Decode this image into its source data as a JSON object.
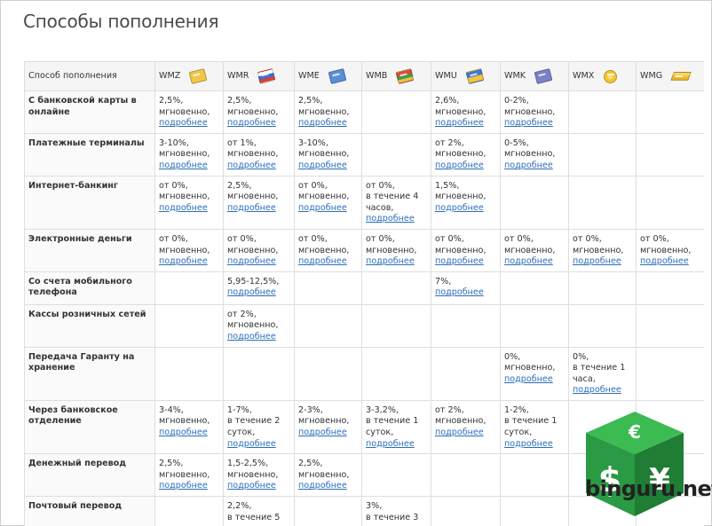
{
  "page": {
    "title": "Способы пополнения"
  },
  "table": {
    "header_label": "Способ пополнения",
    "columns": [
      {
        "code": "WMZ",
        "icon": "wallet-icon",
        "color": "#f0c648"
      },
      {
        "code": "WMR",
        "icon": "wallet-icon",
        "color": "#e36b4a"
      },
      {
        "code": "WME",
        "icon": "wallet-icon",
        "color": "#5a8fd6"
      },
      {
        "code": "WMB",
        "icon": "wallet-icon",
        "color": "#e8b23a"
      },
      {
        "code": "WMU",
        "icon": "wallet-icon",
        "color": "#f2c438"
      },
      {
        "code": "WMK",
        "icon": "wallet-icon",
        "color": "#7b80c9"
      },
      {
        "code": "WMX",
        "icon": "coin-icon",
        "color": "#f3c530"
      },
      {
        "code": "WMG",
        "icon": "gold-bar-icon",
        "color": "#f1b820"
      }
    ],
    "rows": [
      {
        "label": "С банковской карты в онлайне",
        "cells": [
          {
            "lines": [
              "2,5%,",
              "мгновенно,"
            ],
            "link": "подробнее"
          },
          {
            "lines": [
              "2,5%,",
              "мгновенно,"
            ],
            "link": "подробнее"
          },
          {
            "lines": [
              "2,5%,",
              "мгновенно,"
            ],
            "link": "подробнее"
          },
          {
            "lines": [],
            "link": ""
          },
          {
            "lines": [
              "2,6%,",
              "мгновенно,"
            ],
            "link": "подробнее"
          },
          {
            "lines": [
              "0-2%,",
              "мгновенно,"
            ],
            "link": "подробнее"
          },
          {
            "lines": [],
            "link": ""
          },
          {
            "lines": [],
            "link": ""
          }
        ]
      },
      {
        "label": "Платежные терминалы",
        "cells": [
          {
            "lines": [
              "3-10%,",
              "мгновенно,"
            ],
            "link": "подробнее"
          },
          {
            "lines": [
              "от 1%,",
              "мгновенно,"
            ],
            "link": "подробнее"
          },
          {
            "lines": [
              "3-10%,",
              "мгновенно,"
            ],
            "link": "подробнее"
          },
          {
            "lines": [],
            "link": ""
          },
          {
            "lines": [
              "от 2%,",
              "мгновенно,"
            ],
            "link": "подробнее"
          },
          {
            "lines": [
              "0-5%,",
              "мгновенно,"
            ],
            "link": "подробнее"
          },
          {
            "lines": [],
            "link": ""
          },
          {
            "lines": [],
            "link": ""
          }
        ]
      },
      {
        "label": "Интернет-банкинг",
        "cells": [
          {
            "lines": [
              "от 0%,",
              "мгновенно,"
            ],
            "link": "подробнее"
          },
          {
            "lines": [
              "2,5%,",
              "мгновенно,"
            ],
            "link": "подробнее"
          },
          {
            "lines": [
              "от 0%,",
              "мгновенно,"
            ],
            "link": "подробнее"
          },
          {
            "lines": [
              "от 0%,",
              "в течение 4",
              "часов,"
            ],
            "link": "подробнее"
          },
          {
            "lines": [
              "1,5%,",
              "мгновенно,"
            ],
            "link": "подробнее"
          },
          {
            "lines": [],
            "link": ""
          },
          {
            "lines": [],
            "link": ""
          },
          {
            "lines": [],
            "link": ""
          }
        ]
      },
      {
        "label": "Электронные деньги",
        "cells": [
          {
            "lines": [
              "от 0%,",
              "мгновенно,"
            ],
            "link": "подробнее"
          },
          {
            "lines": [
              "от 0%,",
              "мгновенно,"
            ],
            "link": "подробнее"
          },
          {
            "lines": [
              "от 0%,",
              "мгновенно,"
            ],
            "link": "подробнее"
          },
          {
            "lines": [
              "от 0%,",
              "мгновенно,"
            ],
            "link": "подробнее"
          },
          {
            "lines": [
              "от 0%,",
              "мгновенно,"
            ],
            "link": "подробнее"
          },
          {
            "lines": [
              "от 0%,",
              "мгновенно,"
            ],
            "link": "подробнее"
          },
          {
            "lines": [
              "от 0%,",
              "мгновенно,"
            ],
            "link": "подробнее"
          },
          {
            "lines": [
              "от 0%,",
              "мгновенно,"
            ],
            "link": "подробнее"
          }
        ]
      },
      {
        "label": "Со счета мобильного телефона",
        "cells": [
          {
            "lines": [],
            "link": ""
          },
          {
            "lines": [
              "5,95-12,5%,"
            ],
            "link": "подробнее"
          },
          {
            "lines": [],
            "link": ""
          },
          {
            "lines": [],
            "link": ""
          },
          {
            "lines": [
              "7%,"
            ],
            "link": "подробнее"
          },
          {
            "lines": [],
            "link": ""
          },
          {
            "lines": [],
            "link": ""
          },
          {
            "lines": [],
            "link": ""
          }
        ]
      },
      {
        "label": "Кассы розничных сетей",
        "cells": [
          {
            "lines": [],
            "link": ""
          },
          {
            "lines": [
              "от 2%,",
              "мгновенно,"
            ],
            "link": "подробнее"
          },
          {
            "lines": [],
            "link": ""
          },
          {
            "lines": [],
            "link": ""
          },
          {
            "lines": [],
            "link": ""
          },
          {
            "lines": [],
            "link": ""
          },
          {
            "lines": [],
            "link": ""
          },
          {
            "lines": [],
            "link": ""
          }
        ]
      },
      {
        "label": "Передача Гаранту на хранение",
        "cells": [
          {
            "lines": [],
            "link": ""
          },
          {
            "lines": [],
            "link": ""
          },
          {
            "lines": [],
            "link": ""
          },
          {
            "lines": [],
            "link": ""
          },
          {
            "lines": [],
            "link": ""
          },
          {
            "lines": [
              "0%,",
              "мгновенно,"
            ],
            "link": "подробнее"
          },
          {
            "lines": [
              "0%,",
              "в течение 1",
              "часа,"
            ],
            "link": "подробнее"
          },
          {
            "lines": [],
            "link": ""
          }
        ]
      },
      {
        "label": "Через банковское отделение",
        "cells": [
          {
            "lines": [
              "3-4%,",
              "мгновенно,"
            ],
            "link": "подробнее"
          },
          {
            "lines": [
              "1-7%,",
              "в течение 2",
              "суток,"
            ],
            "link": "подробнее"
          },
          {
            "lines": [
              "2-3%,",
              "мгновенно,"
            ],
            "link": "подробнее"
          },
          {
            "lines": [
              "3-3,2%,",
              "в течение 1",
              "суток,"
            ],
            "link": "подробнее"
          },
          {
            "lines": [
              "от 2%,",
              "мгновенно,"
            ],
            "link": "подробнее"
          },
          {
            "lines": [
              "1-2%,",
              "в течение 1",
              "суток,"
            ],
            "link": "подробнее"
          },
          {
            "lines": [],
            "link": ""
          },
          {
            "lines": [],
            "link": ""
          }
        ]
      },
      {
        "label": "Денежный перевод",
        "cells": [
          {
            "lines": [
              "2,5%,",
              "мгновенно,"
            ],
            "link": "подробнее"
          },
          {
            "lines": [
              "1,5-2,5%,",
              "мгновенно,"
            ],
            "link": "подробнее"
          },
          {
            "lines": [
              "2,5%,",
              "мгновенно,"
            ],
            "link": "подробнее"
          },
          {
            "lines": [],
            "link": ""
          },
          {
            "lines": [],
            "link": ""
          },
          {
            "lines": [],
            "link": ""
          },
          {
            "lines": [],
            "link": ""
          },
          {
            "lines": [],
            "link": ""
          }
        ]
      },
      {
        "label": "Почтовый перевод",
        "cells": [
          {
            "lines": [],
            "link": ""
          },
          {
            "lines": [
              "2,2%,",
              "в течение 5"
            ],
            "link": ""
          },
          {
            "lines": [],
            "link": ""
          },
          {
            "lines": [
              "3%,",
              "в течение 3"
            ],
            "link": ""
          },
          {
            "lines": [],
            "link": ""
          },
          {
            "lines": [],
            "link": ""
          },
          {
            "lines": [],
            "link": ""
          },
          {
            "lines": [],
            "link": ""
          }
        ]
      }
    ]
  },
  "watermark": {
    "text": "binguru.net",
    "icon": "currency-cube-icon",
    "symbols": [
      "€",
      "$",
      "¥"
    ],
    "color": "#2ea84a"
  }
}
